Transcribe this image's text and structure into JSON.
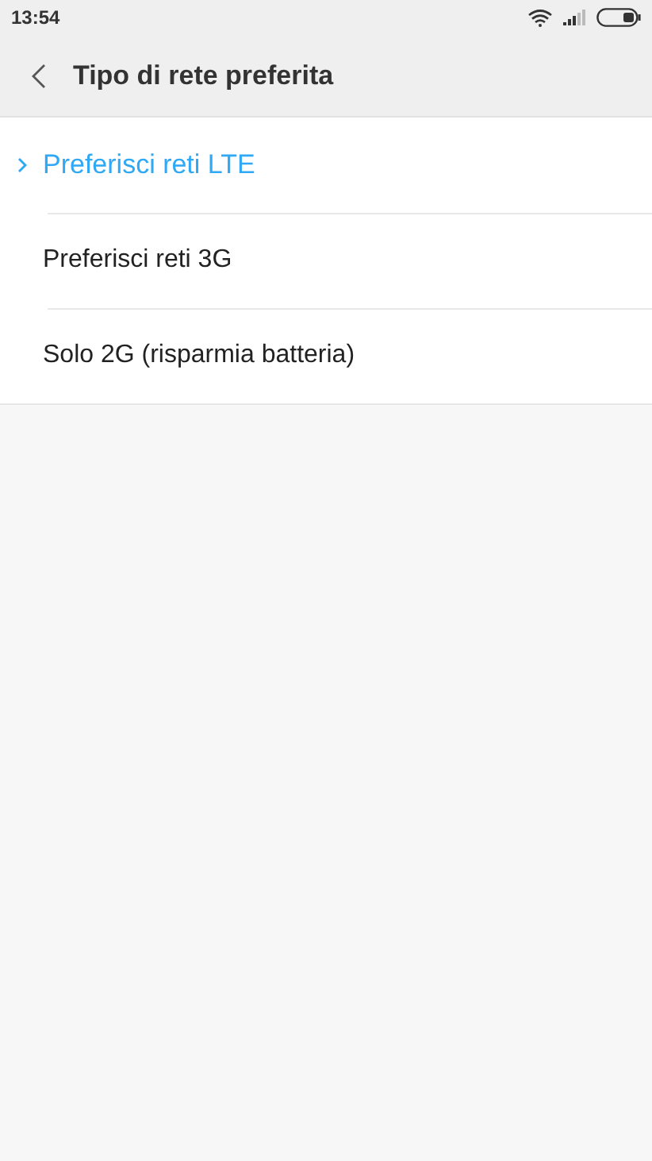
{
  "status_bar": {
    "time": "13:54"
  },
  "header": {
    "title": "Tipo di rete preferita"
  },
  "options": [
    {
      "label": "Preferisci reti LTE",
      "selected": true
    },
    {
      "label": "Preferisci reti 3G",
      "selected": false
    },
    {
      "label": "Solo 2G (risparmia batteria)",
      "selected": false
    }
  ]
}
